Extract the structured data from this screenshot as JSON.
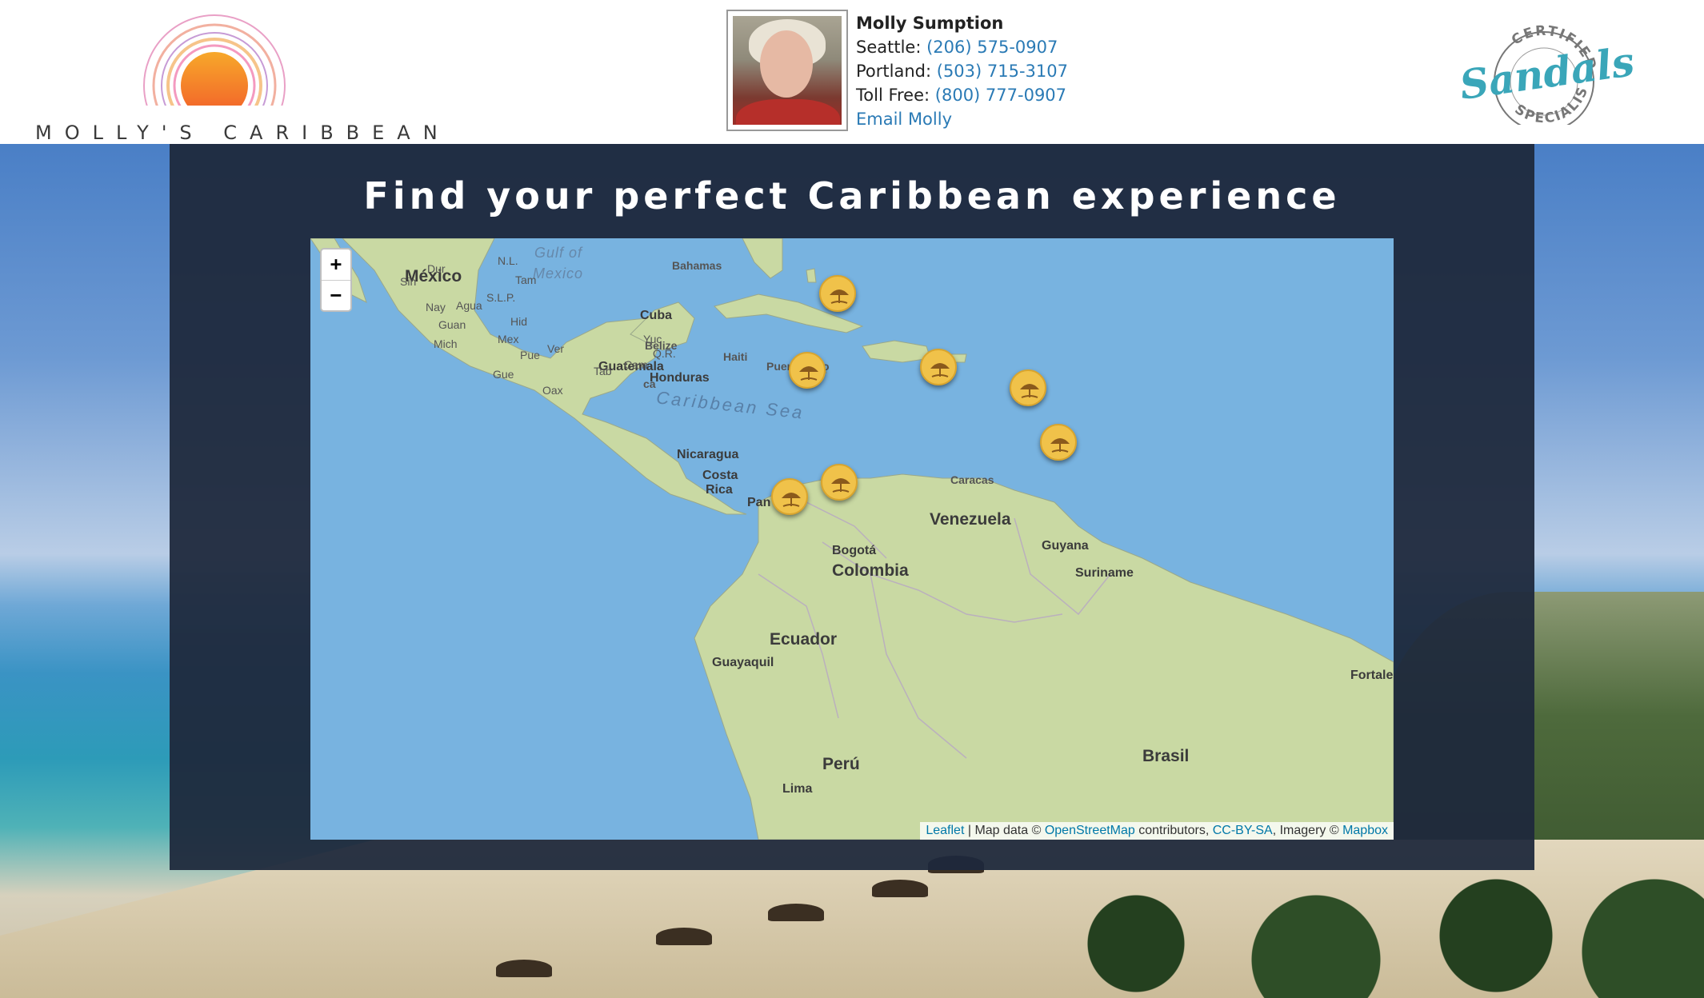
{
  "header": {
    "logo_text": "MOLLY'S CARIBBEAN",
    "contact": {
      "name": "Molly Sumption",
      "seattle_label": "Seattle:",
      "seattle_phone": "(206) 575-0907",
      "portland_label": "Portland:",
      "portland_phone": "(503) 715-3107",
      "tollfree_label": "Toll Free:",
      "tollfree_phone": "(800) 777-0907",
      "email_link": "Email Molly"
    },
    "badge": {
      "brand": "Sandals",
      "top_text": "CERTIFIED",
      "bottom_text": "SPECIALIST"
    }
  },
  "panel": {
    "title": "Find your perfect Caribbean experience"
  },
  "map": {
    "zoom_in": "+",
    "zoom_out": "−",
    "labels": {
      "mexico": "México",
      "gulf_line1": "Gulf of",
      "gulf_line2": "Mexico",
      "bahamas": "Bahamas",
      "cuba": "Cuba",
      "haiti": "Haiti",
      "puerto_rico": "Puerto Rico",
      "caribbean_sea": "Caribbean Sea",
      "belize": "Belize",
      "guatemala": "Guatemala",
      "honduras": "Honduras",
      "nicaragua": "Nicaragua",
      "costa_rica_1": "Costa",
      "costa_rica_2": "Rica",
      "panama": "Pan",
      "caracas": "Caracas",
      "venezuela": "Venezuela",
      "guyana": "Guyana",
      "suriname": "Suriname",
      "bogota": "Bogotá",
      "colombia": "Colombia",
      "ecuador": "Ecuador",
      "guayaquil": "Guayaquil",
      "peru": "Perú",
      "lima": "Lima",
      "brasil": "Brasil",
      "fortaleza": "Fortale",
      "jamaica": "ca",
      "yucatan_1": "Yuc",
      "yucatan_2": "Q.R.",
      "camp": "Cam",
      "tab": "Tab",
      "oax": "Oax",
      "dur": "Dur",
      "sin": "Sin",
      "nl": "N.L.",
      "tam": "Tam",
      "slp": "S.L.P.",
      "agua": "Agua",
      "nay": "Nay",
      "guan": "Guan",
      "hid": "Hid",
      "mich": "Mich",
      "mex": "Mex",
      "pue": "Pue",
      "ver": "Ver",
      "gue": "Gue"
    },
    "markers": [
      "bahamas-resort",
      "jamaica-resort",
      "dominican-resort",
      "antigua-resort",
      "st-lucia-resort",
      "curacao-resort",
      "panama-resort"
    ],
    "attribution": {
      "leaflet": "Leaflet",
      "sep": " | Map data © ",
      "osm": "OpenStreetMap",
      "contrib": " contributors, ",
      "license": "CC-BY-SA",
      "imagery": ", Imagery © ",
      "mapbox": "Mapbox"
    }
  },
  "colors": {
    "panel_bg": "#1e283c",
    "water": "#78b3e0",
    "land": "#c9d9a3",
    "marker": "#f0c24a",
    "link": "#2a7ab5"
  }
}
